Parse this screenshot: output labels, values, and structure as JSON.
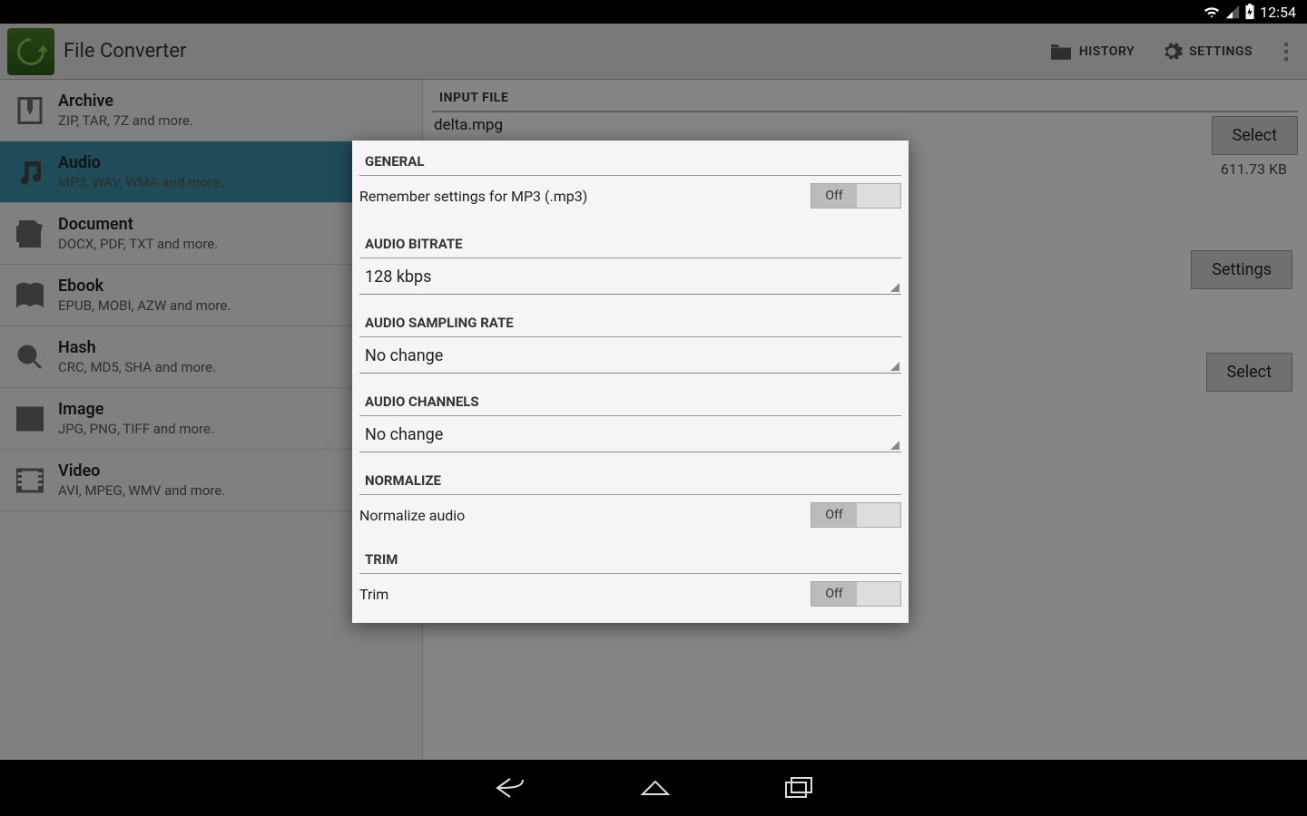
{
  "status": {
    "time": "12:54"
  },
  "actionbar": {
    "title": "File Converter",
    "history": "HISTORY",
    "settings": "SETTINGS"
  },
  "sidebar": {
    "items": [
      {
        "title": "Archive",
        "sub": "ZIP, TAR, 7Z and more."
      },
      {
        "title": "Audio",
        "sub": "MP3, WAV, WMA and more."
      },
      {
        "title": "Document",
        "sub": "DOCX, PDF, TXT and more."
      },
      {
        "title": "Ebook",
        "sub": "EPUB, MOBI, AZW and more."
      },
      {
        "title": "Hash",
        "sub": "CRC, MD5, SHA and more."
      },
      {
        "title": "Image",
        "sub": "JPG, PNG, TIFF and more."
      },
      {
        "title": "Video",
        "sub": "AVI, MPEG, WMV and more."
      }
    ]
  },
  "main": {
    "input_header": "INPUT FILE",
    "input_filename": "delta.mpg",
    "input_size": "611.73 KB",
    "select": "Select",
    "settings": "Settings"
  },
  "dialog": {
    "general_header": "GENERAL",
    "remember_label": "Remember settings for MP3 (.mp3)",
    "remember_state": "Off",
    "bitrate_header": "AUDIO BITRATE",
    "bitrate_value": "128 kbps",
    "sampling_header": "AUDIO SAMPLING RATE",
    "sampling_value": "No change",
    "channels_header": "AUDIO CHANNELS",
    "channels_value": "No change",
    "normalize_header": "NORMALIZE",
    "normalize_label": "Normalize audio",
    "normalize_state": "Off",
    "trim_header": "TRIM",
    "trim_label": "Trim",
    "trim_state": "Off"
  }
}
